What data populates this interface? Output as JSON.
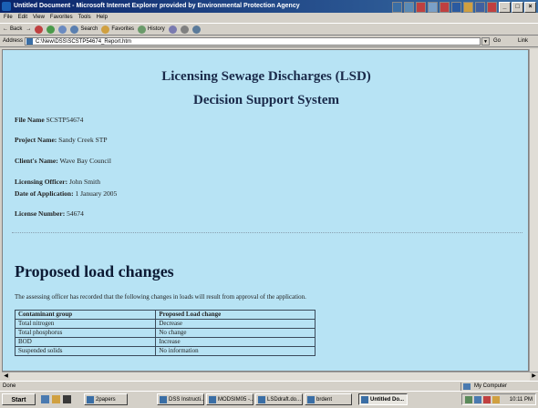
{
  "window": {
    "title": "Untitled Document - Microsoft Internet Explorer provided by Environmental Protection Agency",
    "controls": [
      "_",
      "□",
      "×"
    ]
  },
  "menu": [
    "File",
    "Edit",
    "View",
    "Favorites",
    "Tools",
    "Help"
  ],
  "toolbar": {
    "back": "Back",
    "forward": "→",
    "search": "Search",
    "favorites": "Favorites",
    "history": "History"
  },
  "address": {
    "label": "Address",
    "value": "C:\\New\\DSS\\SCSTP54674_Report.htm",
    "go": "Go",
    "links": "Link"
  },
  "page": {
    "title": "Licensing Sewage Discharges (LSD)",
    "subtitle": "Decision Support System",
    "fields": [
      {
        "label": "File Name",
        "value": "SCSTP54674"
      },
      {
        "label": "Project Name:",
        "value": "Sandy Creek STP"
      },
      {
        "label": "Client's Name:",
        "value": "Wave Bay Council"
      },
      {
        "label": "Licensing Officer:",
        "value": "John Smith"
      },
      {
        "label": "Date of Application:",
        "value": "1 January 2005"
      },
      {
        "label": "License Number:",
        "value": "54674"
      }
    ],
    "section_heading": "Proposed load changes",
    "intro": "The assessing officer has recorded that the following changes in loads will result from approval of the application.",
    "table": {
      "headers": [
        "Contaminant group",
        "Proposed Load change"
      ],
      "rows": [
        [
          "Total nitrogen",
          "Decrease"
        ],
        [
          "Total phosphorus",
          "No change"
        ],
        [
          "BOD",
          "Increase"
        ],
        [
          "Suspended solids",
          "No information"
        ]
      ]
    }
  },
  "status": {
    "left": "Done",
    "zone": "My Computer"
  },
  "taskbar": {
    "start": "Start",
    "tasks": [
      {
        "label": "2papers",
        "active": false
      },
      {
        "label": "DSS Instructi...",
        "active": false
      },
      {
        "label": "MODSIM05 -...",
        "active": false
      },
      {
        "label": "LSDdraft.do...",
        "active": false
      },
      {
        "label": "brdent",
        "active": false
      },
      {
        "label": "Untitled Do...",
        "active": true
      }
    ],
    "clock": "10:11 PM"
  }
}
